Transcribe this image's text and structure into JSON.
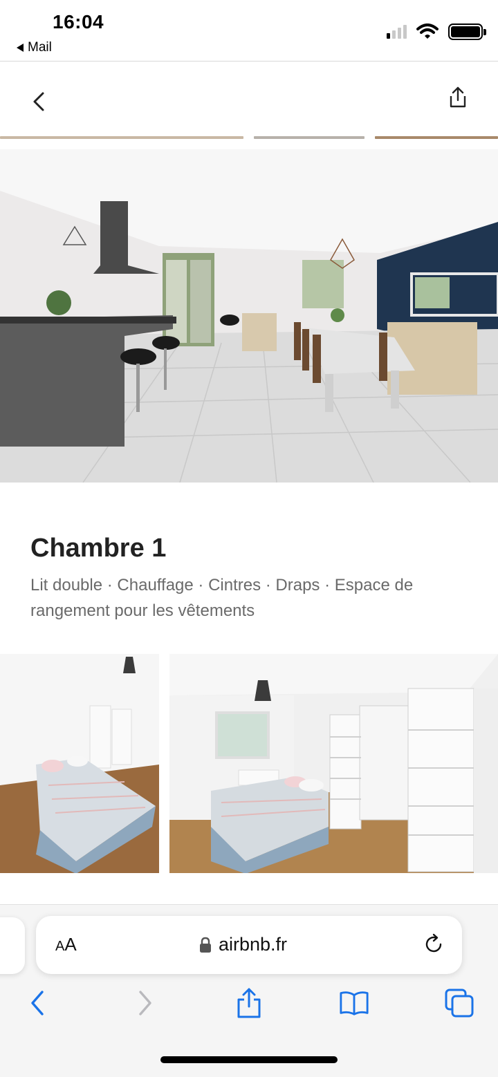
{
  "status_bar": {
    "time": "16:04",
    "back_app": "Mail",
    "signal_bars_active": 1,
    "signal_bars_total": 4,
    "battery_level": 1.0
  },
  "header": {
    "back_icon": "chevron-left-icon",
    "share_icon": "share-icon"
  },
  "room": {
    "title": "Chambre 1",
    "amenities": "Lit double · Chauffage · Cintres · Draps · Espace de rangement pour les vêtements"
  },
  "safari": {
    "text_size_label_small": "A",
    "text_size_label_large": "A",
    "url": "airbnb.fr",
    "lock_icon": "lock-icon",
    "reload_icon": "reload-icon",
    "toolbar": [
      "back-arrow-icon",
      "forward-arrow-icon",
      "share-icon",
      "bookmarks-icon",
      "tabs-icon"
    ]
  },
  "colors": {
    "accent_blue": "#1a73e8",
    "text_primary": "#222222",
    "text_secondary": "#6a6a6a"
  }
}
